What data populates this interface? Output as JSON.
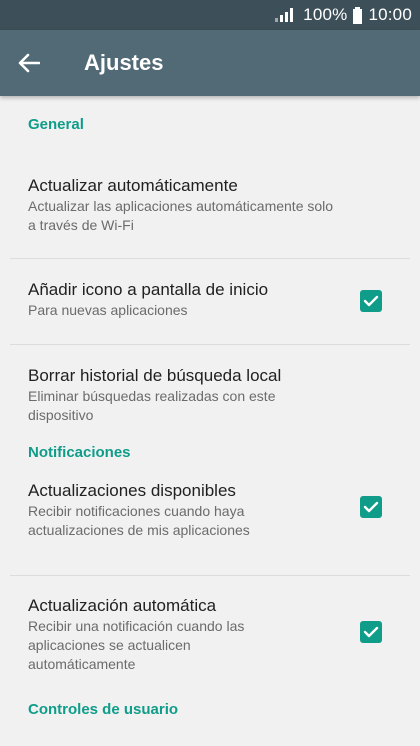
{
  "status_bar": {
    "battery_text": "100%",
    "time": "10:00"
  },
  "app_bar": {
    "title": "Ajustes",
    "back_icon": "arrow-back-icon"
  },
  "sections": [
    {
      "header": "General",
      "items": [
        {
          "title": "Actualizar automáticamente",
          "summary_lines": [
            "Actualizar las aplicaciones automáticamente solo",
            "a través de Wi-Fi"
          ],
          "checked": null
        },
        {
          "title": "Añadir icono a pantalla de inicio",
          "summary_lines": [
            "Para nuevas aplicaciones"
          ],
          "checked": true
        },
        {
          "title": "Borrar historial de búsqueda local",
          "summary_lines": [
            "Eliminar búsquedas realizadas con este",
            "dispositivo"
          ],
          "checked": null
        }
      ]
    },
    {
      "header": "Notificaciones",
      "items": [
        {
          "title": "Actualizaciones disponibles",
          "summary_lines": [
            "Recibir notificaciones cuando haya",
            "actualizaciones de mis aplicaciones"
          ],
          "checked": true
        },
        {
          "title": "Actualización automática",
          "summary_lines": [
            "Recibir una notificación cuando las",
            "aplicaciones se actualicen",
            "automáticamente"
          ],
          "checked": true
        }
      ]
    },
    {
      "header": "Controles de usuario",
      "items": []
    }
  ],
  "colors": {
    "accent": "#0f9d8a",
    "app_bar": "#526a76",
    "status_bar": "#3d4f58",
    "background": "#f1f1f1"
  }
}
